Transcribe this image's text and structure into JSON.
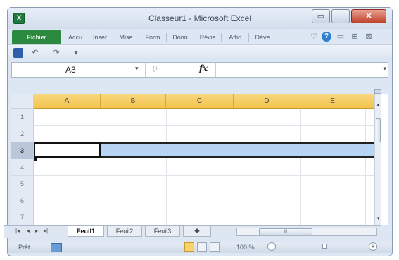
{
  "window": {
    "title": "Classeur1 - Microsoft Excel",
    "app_icon": "X"
  },
  "window_controls": {
    "minimize": "▭",
    "maximize": "☐",
    "close": "✕"
  },
  "ribbon": {
    "file_tab": "Fichier",
    "tabs": [
      "Accu",
      "Inser",
      "Mise",
      "Form",
      "Donn",
      "Révis",
      "Affic",
      "Déve"
    ],
    "right_icons": [
      "minimize-ribbon-icon",
      "help-icon",
      "window-restore-icon",
      "close-workbook-icon"
    ],
    "help_glyph": "?"
  },
  "quick_access": {
    "undo": "↶",
    "redo": "↷",
    "customize": "▾"
  },
  "formula_bar": {
    "name_box": "A3",
    "name_box_arrow": "▾",
    "cancel": "(+",
    "fx": "fx",
    "expand": "▾",
    "content": ""
  },
  "columns": [
    "A",
    "B",
    "C",
    "D",
    "E"
  ],
  "rows": [
    "1",
    "2",
    "3",
    "4",
    "5",
    "6",
    "7"
  ],
  "selected_row": "3",
  "active_cell": "A3",
  "sheets": {
    "nav": [
      "|◂",
      "◂",
      "▸",
      "▸|"
    ],
    "tabs": [
      "Feuil1",
      "Feuil2",
      "Feuil3"
    ],
    "active": "Feuil1"
  },
  "scrollbar": {
    "up": "▴",
    "down": "▾",
    "hscroll_thumb": "III"
  },
  "status": {
    "mode": "Prêt",
    "zoom": "100 %",
    "zoom_in": "+"
  },
  "colors": {
    "file_tab": "#2b8a3e",
    "column_header": "#f3c44e",
    "selection": "#b8d4f4",
    "close_button": "#c0432d"
  }
}
